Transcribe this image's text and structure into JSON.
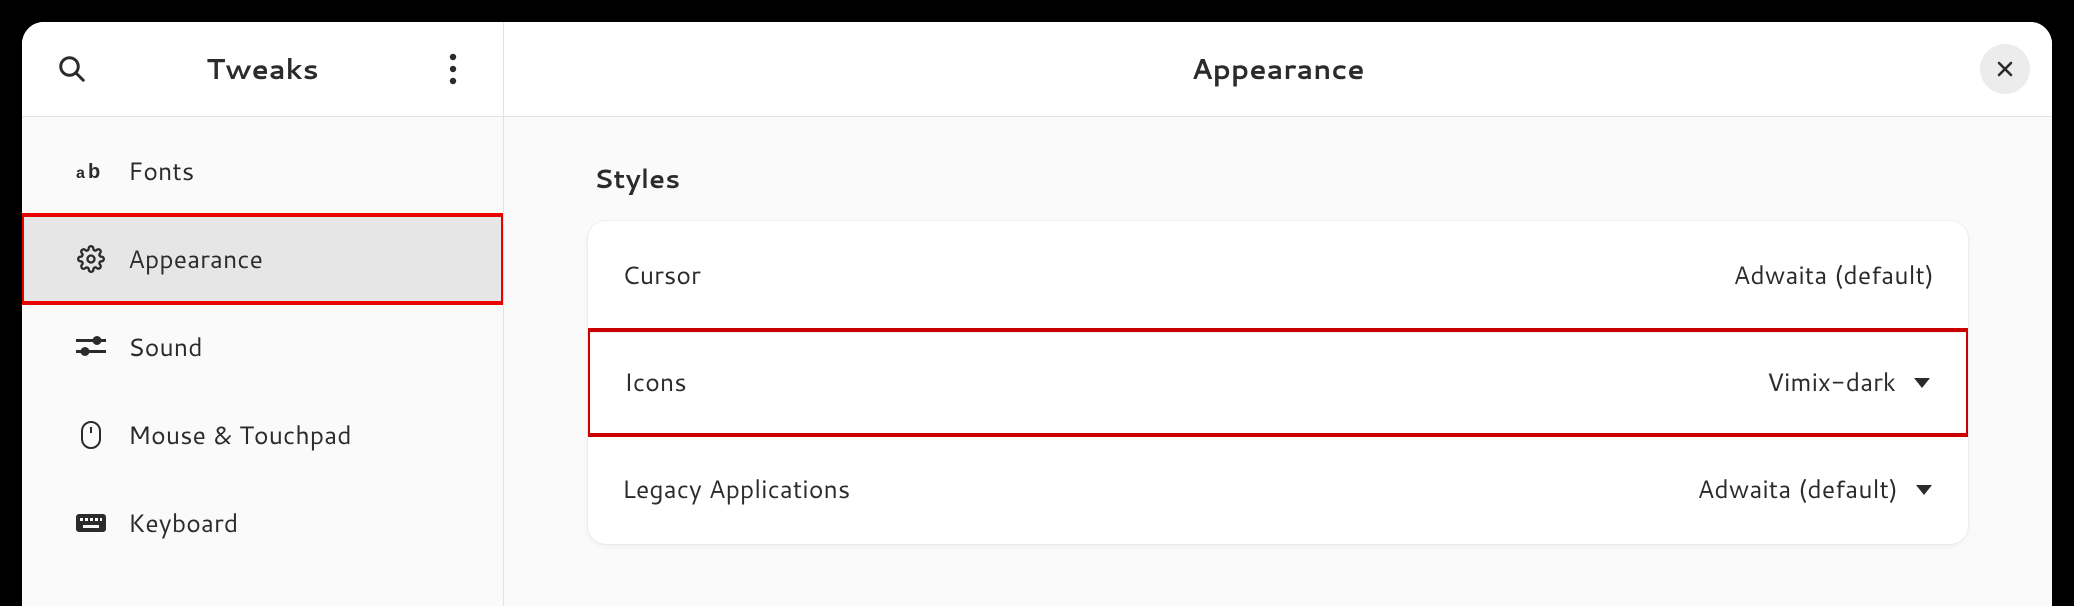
{
  "sidebar": {
    "title": "Tweaks",
    "items": [
      {
        "label": "Fonts",
        "icon": "fonts-icon",
        "selected": false,
        "highlight": false
      },
      {
        "label": "Appearance",
        "icon": "gear-icon",
        "selected": true,
        "highlight": true
      },
      {
        "label": "Sound",
        "icon": "sound-icon",
        "selected": false,
        "highlight": false
      },
      {
        "label": "Mouse & Touchpad",
        "icon": "mouse-icon",
        "selected": false,
        "highlight": false
      },
      {
        "label": "Keyboard",
        "icon": "keyboard-icon",
        "selected": false,
        "highlight": false
      }
    ]
  },
  "main": {
    "title": "Appearance",
    "section_label": "Styles",
    "rows": [
      {
        "label": "Cursor",
        "value": "Adwaita (default)",
        "has_dropdown": false,
        "highlight": false
      },
      {
        "label": "Icons",
        "value": "Vimix-dark",
        "has_dropdown": true,
        "highlight": true
      },
      {
        "label": "Legacy Applications",
        "value": "Adwaita (default)",
        "has_dropdown": true,
        "highlight": false
      }
    ]
  }
}
